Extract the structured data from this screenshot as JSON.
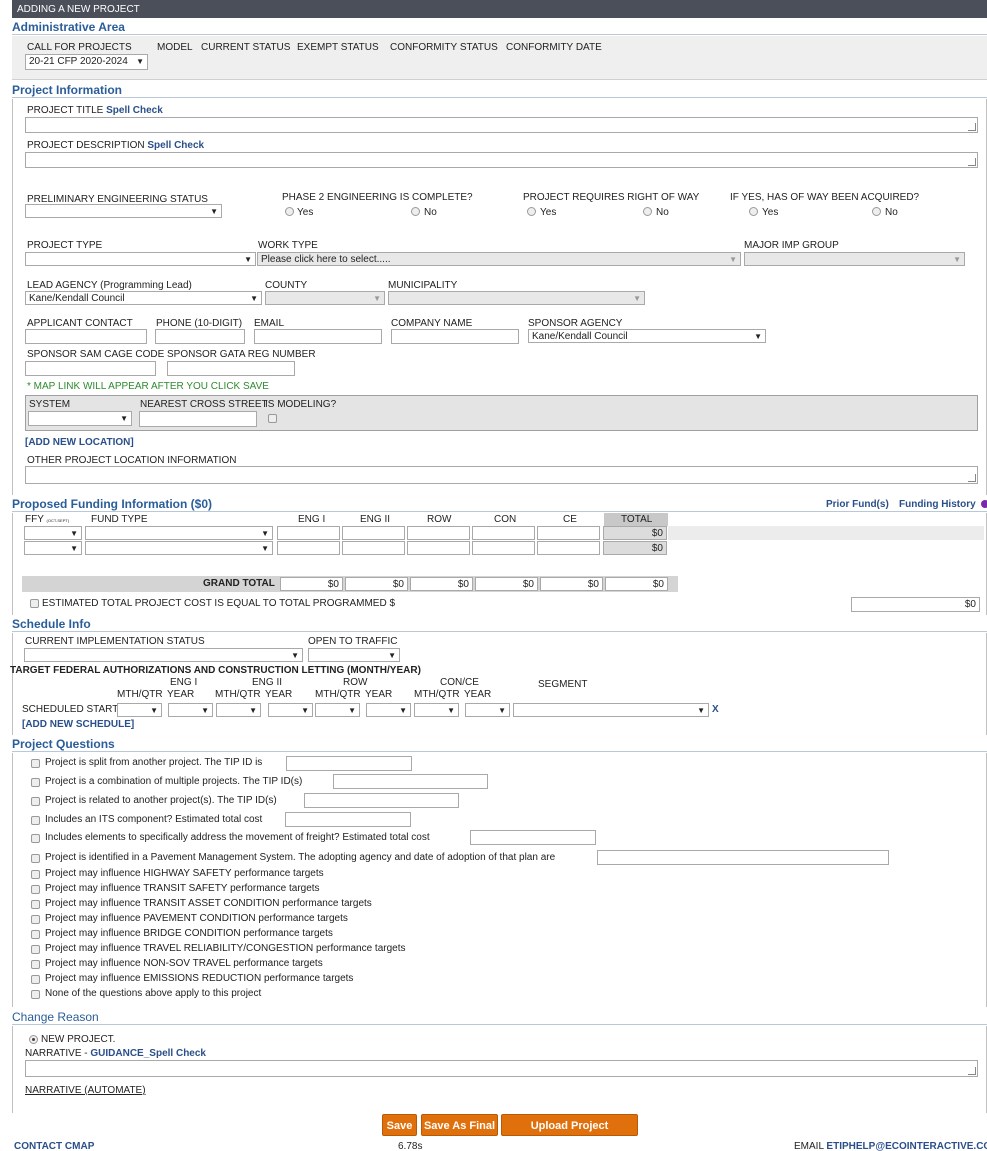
{
  "header": {
    "title": "ADDING A NEW PROJECT"
  },
  "admin": {
    "title": "Administrative Area",
    "labels": [
      "CALL FOR PROJECTS",
      "MODEL",
      "CURRENT STATUS",
      "EXEMPT STATUS",
      "CONFORMITY STATUS",
      "CONFORMITY DATE"
    ],
    "call_value": "20-21 CFP 2020-2024"
  },
  "project_info": {
    "title": "Project Information",
    "project_title_label": "PROJECT TITLE",
    "project_description_label": "PROJECT DESCRIPTION",
    "spell_check": "Spell Check",
    "pe_status_label": "PRELIMINARY ENGINEERING STATUS",
    "phase2_label": "PHASE 2 ENGINEERING IS COMPLETE?",
    "row_label": "PROJECT REQUIRES RIGHT OF WAY",
    "row_acquired_label": "IF YES, HAS OF WAY BEEN ACQUIRED?",
    "yes": "Yes",
    "no": "No",
    "project_type_label": "PROJECT TYPE",
    "work_type_label": "WORK TYPE",
    "work_type_value": "Please click here to select.....",
    "major_imp_label": "MAJOR IMP GROUP",
    "lead_agency_label": "LEAD AGENCY (Programming Lead)",
    "lead_agency_value": "Kane/Kendall Council",
    "county_label": "COUNTY",
    "municipality_label": "MUNICIPALITY",
    "applicant_label": "APPLICANT CONTACT",
    "phone_label": "PHONE (10-DIGIT)",
    "email_label": "EMAIL",
    "company_label": "COMPANY NAME",
    "sponsor_label": "SPONSOR AGENCY",
    "sponsor_value": "Kane/Kendall Council",
    "sam_label": "SPONSOR SAM CAGE CODE",
    "gata_label": "SPONSOR GATA REG NUMBER",
    "map_note": "* MAP LINK WILL APPEAR AFTER YOU CLICK SAVE",
    "system_label": "SYSTEM",
    "cross_street_label": "NEAREST CROSS STREET",
    "modeling_label": "IS MODELING?",
    "add_location": "[ADD NEW LOCATION]",
    "other_location_label": "OTHER PROJECT LOCATION INFORMATION"
  },
  "funding": {
    "title": "Proposed Funding Information ($0)",
    "prior_funds": "Prior Fund(s)",
    "history": "Funding History",
    "ffy_label": "FFY",
    "ffy_sub": "(OCT-SEPT)",
    "fund_type_label": "FUND TYPE",
    "columns": [
      "ENG I",
      "ENG II",
      "ROW",
      "CON",
      "CE",
      "TOTAL"
    ],
    "row_totals": [
      "$0",
      "$0"
    ],
    "grand_total_label": "GRAND TOTAL",
    "grand_totals": [
      "$0",
      "$0",
      "$0",
      "$0",
      "$0",
      "$0"
    ],
    "estimated_label": "ESTIMATED TOTAL PROJECT COST IS EQUAL TO TOTAL PROGRAMMED $",
    "estimated_value": "$0"
  },
  "schedule": {
    "title": "Schedule Info",
    "impl_label": "CURRENT IMPLEMENTATION STATUS",
    "traffic_label": "OPEN TO TRAFFIC",
    "target_label": "TARGET FEDERAL AUTHORIZATIONS AND CONSTRUCTION LETTING (MONTH/YEAR)",
    "phases": [
      "ENG I",
      "ENG II",
      "ROW",
      "CON/CE"
    ],
    "mth_qtr": "MTH/QTR",
    "year": "YEAR",
    "segment_label": "SEGMENT",
    "scheduled_start": "SCHEDULED START",
    "remove": "X",
    "add_schedule": "[ADD NEW SCHEDULE]"
  },
  "questions": {
    "title": "Project Questions",
    "items": [
      "Project is split from another project. The TIP ID is",
      "Project is a combination of multiple projects.  The TIP ID(s)",
      "Project is related to another project(s).  The TIP ID(s)",
      "Includes an ITS component?  Estimated total cost",
      "Includes elements to specifically address the movement of freight?  Estimated total cost",
      "Project is identified in a Pavement Management System.  The adopting agency and date of adoption of that plan are",
      "Project may influence HIGHWAY SAFETY performance targets",
      "Project may influence TRANSIT SAFETY performance targets",
      "Project may influence TRANSIT ASSET CONDITION performance targets",
      "Project may influence PAVEMENT CONDITION performance targets",
      "Project may influence BRIDGE CONDITION performance targets",
      "Project may influence TRAVEL RELIABILITY/CONGESTION performance targets",
      "Project may influence NON-SOV TRAVEL performance targets",
      "Project may influence EMISSIONS REDUCTION performance targets",
      "None of the questions above apply to this project"
    ]
  },
  "change": {
    "title": "Change Reason",
    "new_project": "NEW PROJECT.",
    "narrative_label": "NARRATIVE - ",
    "guidance": "GUIDANCE",
    "spell_check": "Spell Check",
    "narrative_auto": "NARRATIVE (AUTOMATE)"
  },
  "buttons": {
    "save": "Save",
    "save_final": "Save As Final",
    "upload": "Upload Project Documents"
  },
  "footer": {
    "contact": "CONTACT CMAP",
    "time": "6.78s",
    "email_label": "EMAIL ",
    "email": "ETIPHELP@ECOINTERACTIVE.COM"
  },
  "colors": {
    "header_bg": "#4b4f5a",
    "section_title": "#2a5d99",
    "link": "#2a4f8a",
    "button": "#e0700c",
    "note": "#2e8b2e"
  }
}
